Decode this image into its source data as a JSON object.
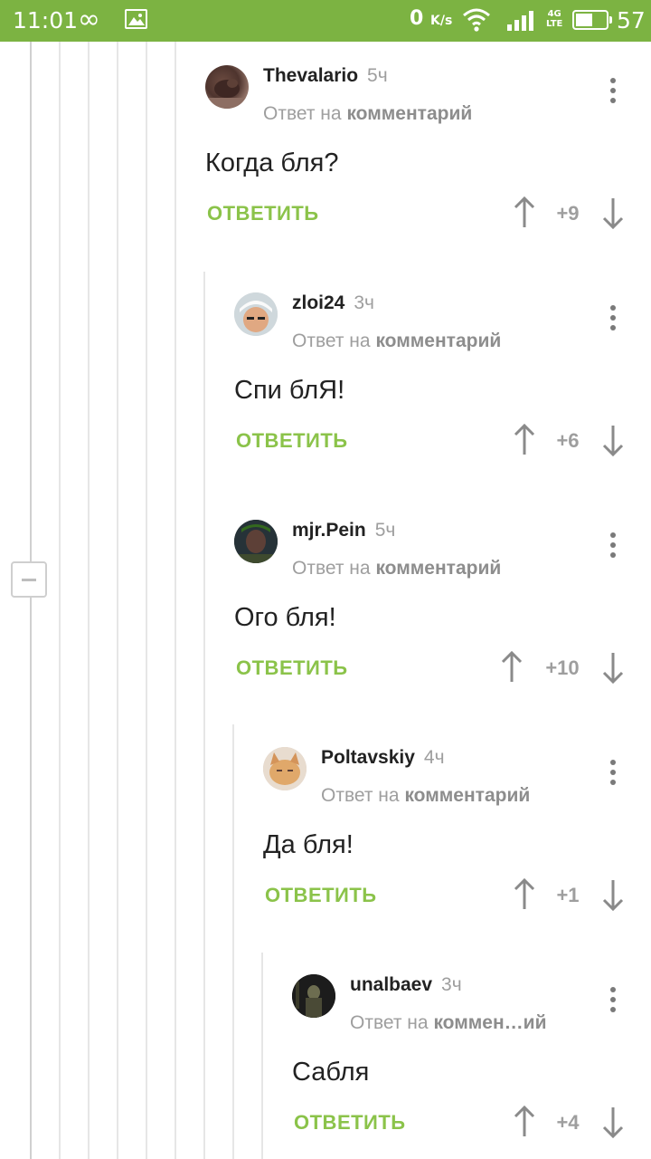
{
  "status_bar": {
    "time": "11:01",
    "speed_value": "0",
    "speed_unit": "K/s",
    "network_top": "4G",
    "network_bottom": "LTE",
    "battery_percent": "57",
    "battery_level": 0.57,
    "accent_color": "#7cb342"
  },
  "comments": [
    {
      "author": "Thevalario",
      "time": "5ч",
      "reply_prefix": "Ответ на",
      "reply_target": "комментарий",
      "text": "Когда бля?",
      "reply_label": "ОТВЕТИТЬ",
      "score": "+9"
    },
    {
      "author": "zloi24",
      "time": "3ч",
      "reply_prefix": "Ответ на",
      "reply_target": "комментарий",
      "text": "Спи блЯ!",
      "reply_label": "ОТВЕТИТЬ",
      "score": "+6"
    },
    {
      "author": "mjr.Pein",
      "time": "5ч",
      "reply_prefix": "Ответ на",
      "reply_target": "комментарий",
      "text": "Ого бля!",
      "reply_label": "ОТВЕТИТЬ",
      "score": "+10"
    },
    {
      "author": "Poltavskiy",
      "time": "4ч",
      "reply_prefix": "Ответ на",
      "reply_target": "комментарий",
      "text": "Да бля!",
      "reply_label": "ОТВЕТИТЬ",
      "score": "+1"
    },
    {
      "author": "unalbaev",
      "time": "3ч",
      "reply_prefix": "Ответ на",
      "reply_target": "коммен…ий",
      "text": "Сабля",
      "reply_label": "ОТВЕТИТЬ",
      "score": "+4"
    }
  ],
  "icons": {
    "upvote": "arrow-up-icon",
    "downvote": "arrow-down-icon",
    "more": "more-vertical-icon",
    "collapse": "collapse-minus-icon"
  },
  "colors": {
    "reply_green": "#8bc34a",
    "muted_gray": "#9e9e9e"
  }
}
